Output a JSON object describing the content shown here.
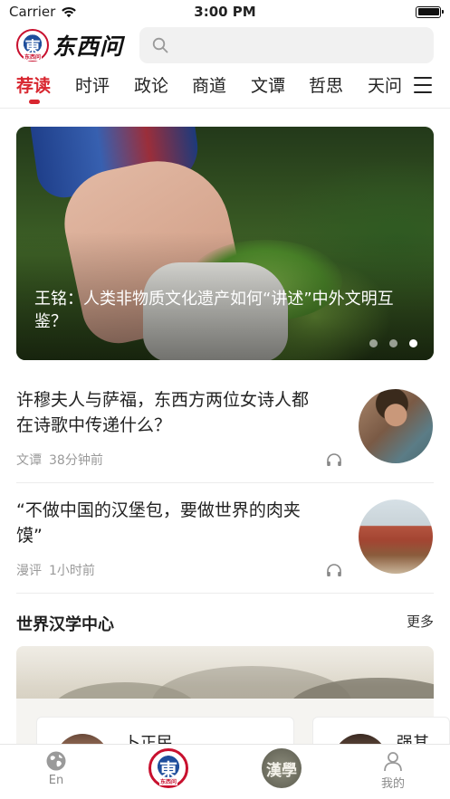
{
  "status_bar": {
    "carrier": "Carrier",
    "time": "3:00 PM"
  },
  "header": {
    "logo_text": "东西问",
    "logo_badge": "東",
    "logo_badge_sub": "东西问",
    "search_placeholder": ""
  },
  "tabs": [
    {
      "label": "荐读",
      "active": true
    },
    {
      "label": "时评",
      "active": false
    },
    {
      "label": "政论",
      "active": false
    },
    {
      "label": "商道",
      "active": false
    },
    {
      "label": "文谭",
      "active": false
    },
    {
      "label": "哲思",
      "active": false
    },
    {
      "label": "天问",
      "active": false
    }
  ],
  "hero": {
    "title": "王铭：人类非物质文化遗产如何“讲述”中外文明互鉴？",
    "slide_count": 3,
    "active_slide": 3
  },
  "articles": [
    {
      "title": "许穆夫人与萨福，东西方两位女诗人都在诗歌中传递什么？",
      "category": "文谭",
      "time": "38分钟前"
    },
    {
      "title": "“不做中国的汉堡包，要做世界的肉夹馍”",
      "category": "漫评",
      "time": "1小时前"
    }
  ],
  "section": {
    "title": "世界汉学中心",
    "more": "更多",
    "scholars": [
      {
        "name": "卜正民"
      },
      {
        "name": "强其"
      }
    ]
  },
  "bottom_nav": {
    "items": [
      {
        "label": "En",
        "icon": "globe-icon"
      },
      {
        "label": "",
        "icon": "dongxiwen-logo-icon",
        "badge_text": "東",
        "badge_sub": "东西问"
      },
      {
        "label": "",
        "icon": "hanxue-icon",
        "badge_text": "漢學"
      },
      {
        "label": "我的",
        "icon": "user-icon"
      }
    ]
  },
  "colors": {
    "accent": "#d8262f",
    "logo_blue": "#1f4e9c",
    "meta_gray": "#9a9a9a"
  }
}
